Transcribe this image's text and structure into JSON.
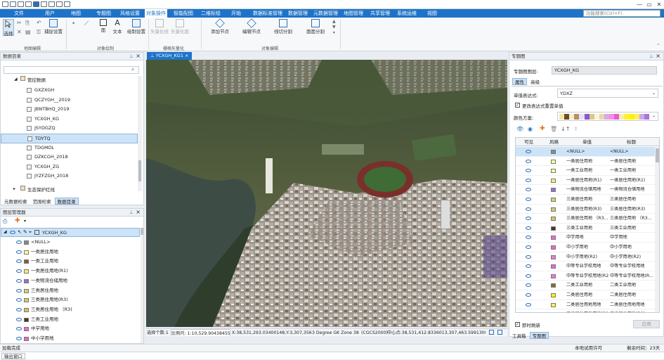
{
  "title_bar": {
    "search_placeholder": "功能搜索(Ctrl+F)",
    "minimize": "—",
    "restore": "▭",
    "close": "✕"
  },
  "menu": [
    "文件",
    "用户",
    "地图",
    "专题图",
    "风格设置",
    "对象操作",
    "智能配图",
    "二维标绘",
    "开始",
    "数据标准管理",
    "数据管理",
    "元数据管理",
    "地图管理",
    "共享管理",
    "系统运维",
    "视图"
  ],
  "menu_active_index": 5,
  "ribbon": {
    "groups": [
      "地图编辑",
      "对象绘制",
      "栅格矢量化",
      "对象编辑"
    ],
    "select": "选择",
    "capture": "捕捉设置",
    "face": "面",
    "text": "文本",
    "draw_settings": "绘制设置",
    "vec_line": "矢量化线",
    "vec_face": "矢量化面",
    "add_node": "添加节点",
    "edit_node": "编辑节点",
    "line_split": "线切分割",
    "face_split": "面面分割"
  },
  "data_catalog": {
    "title": "数据目录",
    "parent": "管控数据",
    "items": [
      "GXZXGH",
      "QCZYGH__2019",
      "JBNTBHQ_2019",
      "YCXGH_KG",
      "JSYDGZQ",
      "TDYTQ",
      "TDGMDL",
      "DZKCGH_2018",
      "YCXGH_ZG",
      "JYZFZGH_2018"
    ],
    "selected_index": 5,
    "next": "生态保护红线",
    "tabs": [
      "元数据检索",
      "范围检索",
      "数据目录"
    ]
  },
  "layer_manager": {
    "title": "图层管理器",
    "layer": "YCXGH_KG",
    "items": [
      {
        "label": "<NULL>",
        "color": "#8a8a8a"
      },
      {
        "label": "一类居住用地",
        "color": "#ffff99"
      },
      {
        "label": "一类工业用地",
        "color": "#8b5a3c"
      },
      {
        "label": "一类居住用地(R1)",
        "color": "#f7ef6b"
      },
      {
        "label": "一类物流仓储用地",
        "color": "#9b6fd6"
      },
      {
        "label": "三类居住用地",
        "color": "#d9d17a"
      },
      {
        "label": "三类居住用地(R3)",
        "color": "#d6cc6a"
      },
      {
        "label": "三类居住用地 （R3)",
        "color": "#cfc766"
      },
      {
        "label": "三类工业用地",
        "color": "#4e3424"
      },
      {
        "label": "中学用地",
        "color": "#f06ad0"
      },
      {
        "label": "中小学用地",
        "color": "#ee66cc"
      }
    ]
  },
  "map": {
    "tab": "YCXGH_KG1"
  },
  "thematic": {
    "title": "专题图",
    "layer_label": "专题图图层:",
    "layer_value": "YCXGH_KG",
    "tabs": [
      "属性",
      "高级"
    ],
    "expr_label": "单值表达式:",
    "expr_value": "YDXZ",
    "update_label": "更改表达式重置单值",
    "color_label": "颜色方案:",
    "palette": [
      "#f8e6a0",
      "#6b4a2f",
      "#f3f0c8",
      "#b88f6a",
      "#e8e0f5",
      "#8e56c8",
      "#d7c98c",
      "#f9f6d8",
      "#e7d7a6",
      "#d8a9e0",
      "#f48ce0",
      "#e060d0",
      "#f5f0a8",
      "#ffef2f",
      "#fff200",
      "#ffef60",
      "#c8a8e8",
      "#b070d8"
    ],
    "headers": [
      "可见",
      "风格",
      "单值",
      "标题"
    ],
    "rows": [
      {
        "value": "<NULL>",
        "label": "<NULL>",
        "color": "#8a8a8a"
      },
      {
        "value": "一类居住用地",
        "label": "一类居住用地",
        "color": "#ffff99"
      },
      {
        "value": "一类工业用地",
        "label": "一类工业用地",
        "color": "#ffffa0"
      },
      {
        "value": "一类居住用地(R1)",
        "label": "一类居住用地(R1)",
        "color": "#f7ef6b"
      },
      {
        "value": "一类物流仓储用地",
        "label": "一类物流仓储用地",
        "color": "#9b6fd6"
      },
      {
        "value": "三类居住用地",
        "label": "三类居住用地",
        "color": "#d9d17a"
      },
      {
        "value": "三类居住用地(R3)",
        "label": "三类居住用地(R3)",
        "color": "#d6cc6a"
      },
      {
        "value": "三类居住用地 （R3...",
        "label": "三类居住用地 （R3...",
        "color": "#cfc766"
      },
      {
        "value": "三类工业用地",
        "label": "三类工业用地",
        "color": "#4e3424"
      },
      {
        "value": "中学用地",
        "label": "中学用地",
        "color": "#f06ad0"
      },
      {
        "value": "中小学用地",
        "label": "中小学用地",
        "color": "#ee66cc"
      },
      {
        "value": "中小学用地(R2)",
        "label": "中小学用地(R2)",
        "color": "#f07ad8"
      },
      {
        "value": "中等专业学校用地",
        "label": "中等专业学校用地",
        "color": "#e36ad0"
      },
      {
        "value": "中等专业学校用地(R2)",
        "label": "中等专业学校用地(R...",
        "color": "#ec7ad6"
      },
      {
        "value": "二类工业用地",
        "label": "二类工业用地",
        "color": "#8b6a2a"
      },
      {
        "value": "二类居住用地",
        "label": "二类居住用地",
        "color": "#fff200"
      },
      {
        "value": "二类居住用地用地",
        "label": "二类居住用地用地",
        "color": "#fff34a"
      },
      {
        "value": "二类居住用地用地(R2)",
        "label": "二类居住用地(R2)",
        "color": "#ffee33"
      }
    ],
    "live_refresh": "即时刷新",
    "apply": "应用",
    "bottom_tabs": [
      "工具箱",
      "专题图"
    ]
  },
  "map_status": {
    "selected": "选择个数:1",
    "scale": "比例尺: 1:10,529.90438455",
    "coords": "X:38,531,293.03400148,Y:3,307,356",
    "proj": "3 Degree GK Zone 38",
    "cgcs": "(CGCS2000)",
    "center": "中心点:38,531,412.8336013,307,463.59913005"
  },
  "status": {
    "left": "加载完成",
    "license": "本地试用许可",
    "days": "剩余时间：23天",
    "output": "输出窗口"
  }
}
